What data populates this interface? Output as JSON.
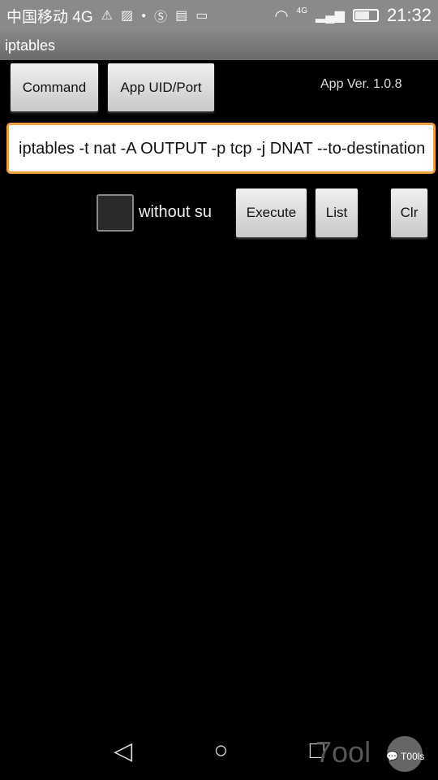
{
  "status_bar": {
    "carrier": "中国移动 4G",
    "network_badge": "4G",
    "time": "21:32",
    "icons": [
      "warning-icon",
      "image-icon",
      "bug-icon",
      "circle-s-icon",
      "keyboard-icon",
      "message-icon",
      "wifi-icon",
      "signal-icon",
      "battery-icon"
    ]
  },
  "app": {
    "title": "iptables",
    "version": "App Ver. 1.0.8"
  },
  "buttons": {
    "command": "Command",
    "app_uid_port": "App UID/Port",
    "execute": "Execute",
    "list": "List",
    "clr": "Clr"
  },
  "command_input": {
    "value": "iptables -t nat -A OUTPUT -p tcp -j DNAT --to-destination"
  },
  "checkbox": {
    "label": "without su",
    "checked": false
  },
  "colors": {
    "input_border": "#f0a040",
    "status_bar": "#8a8a8a"
  },
  "watermark": {
    "text": "7ool",
    "badge": "T00ls"
  }
}
